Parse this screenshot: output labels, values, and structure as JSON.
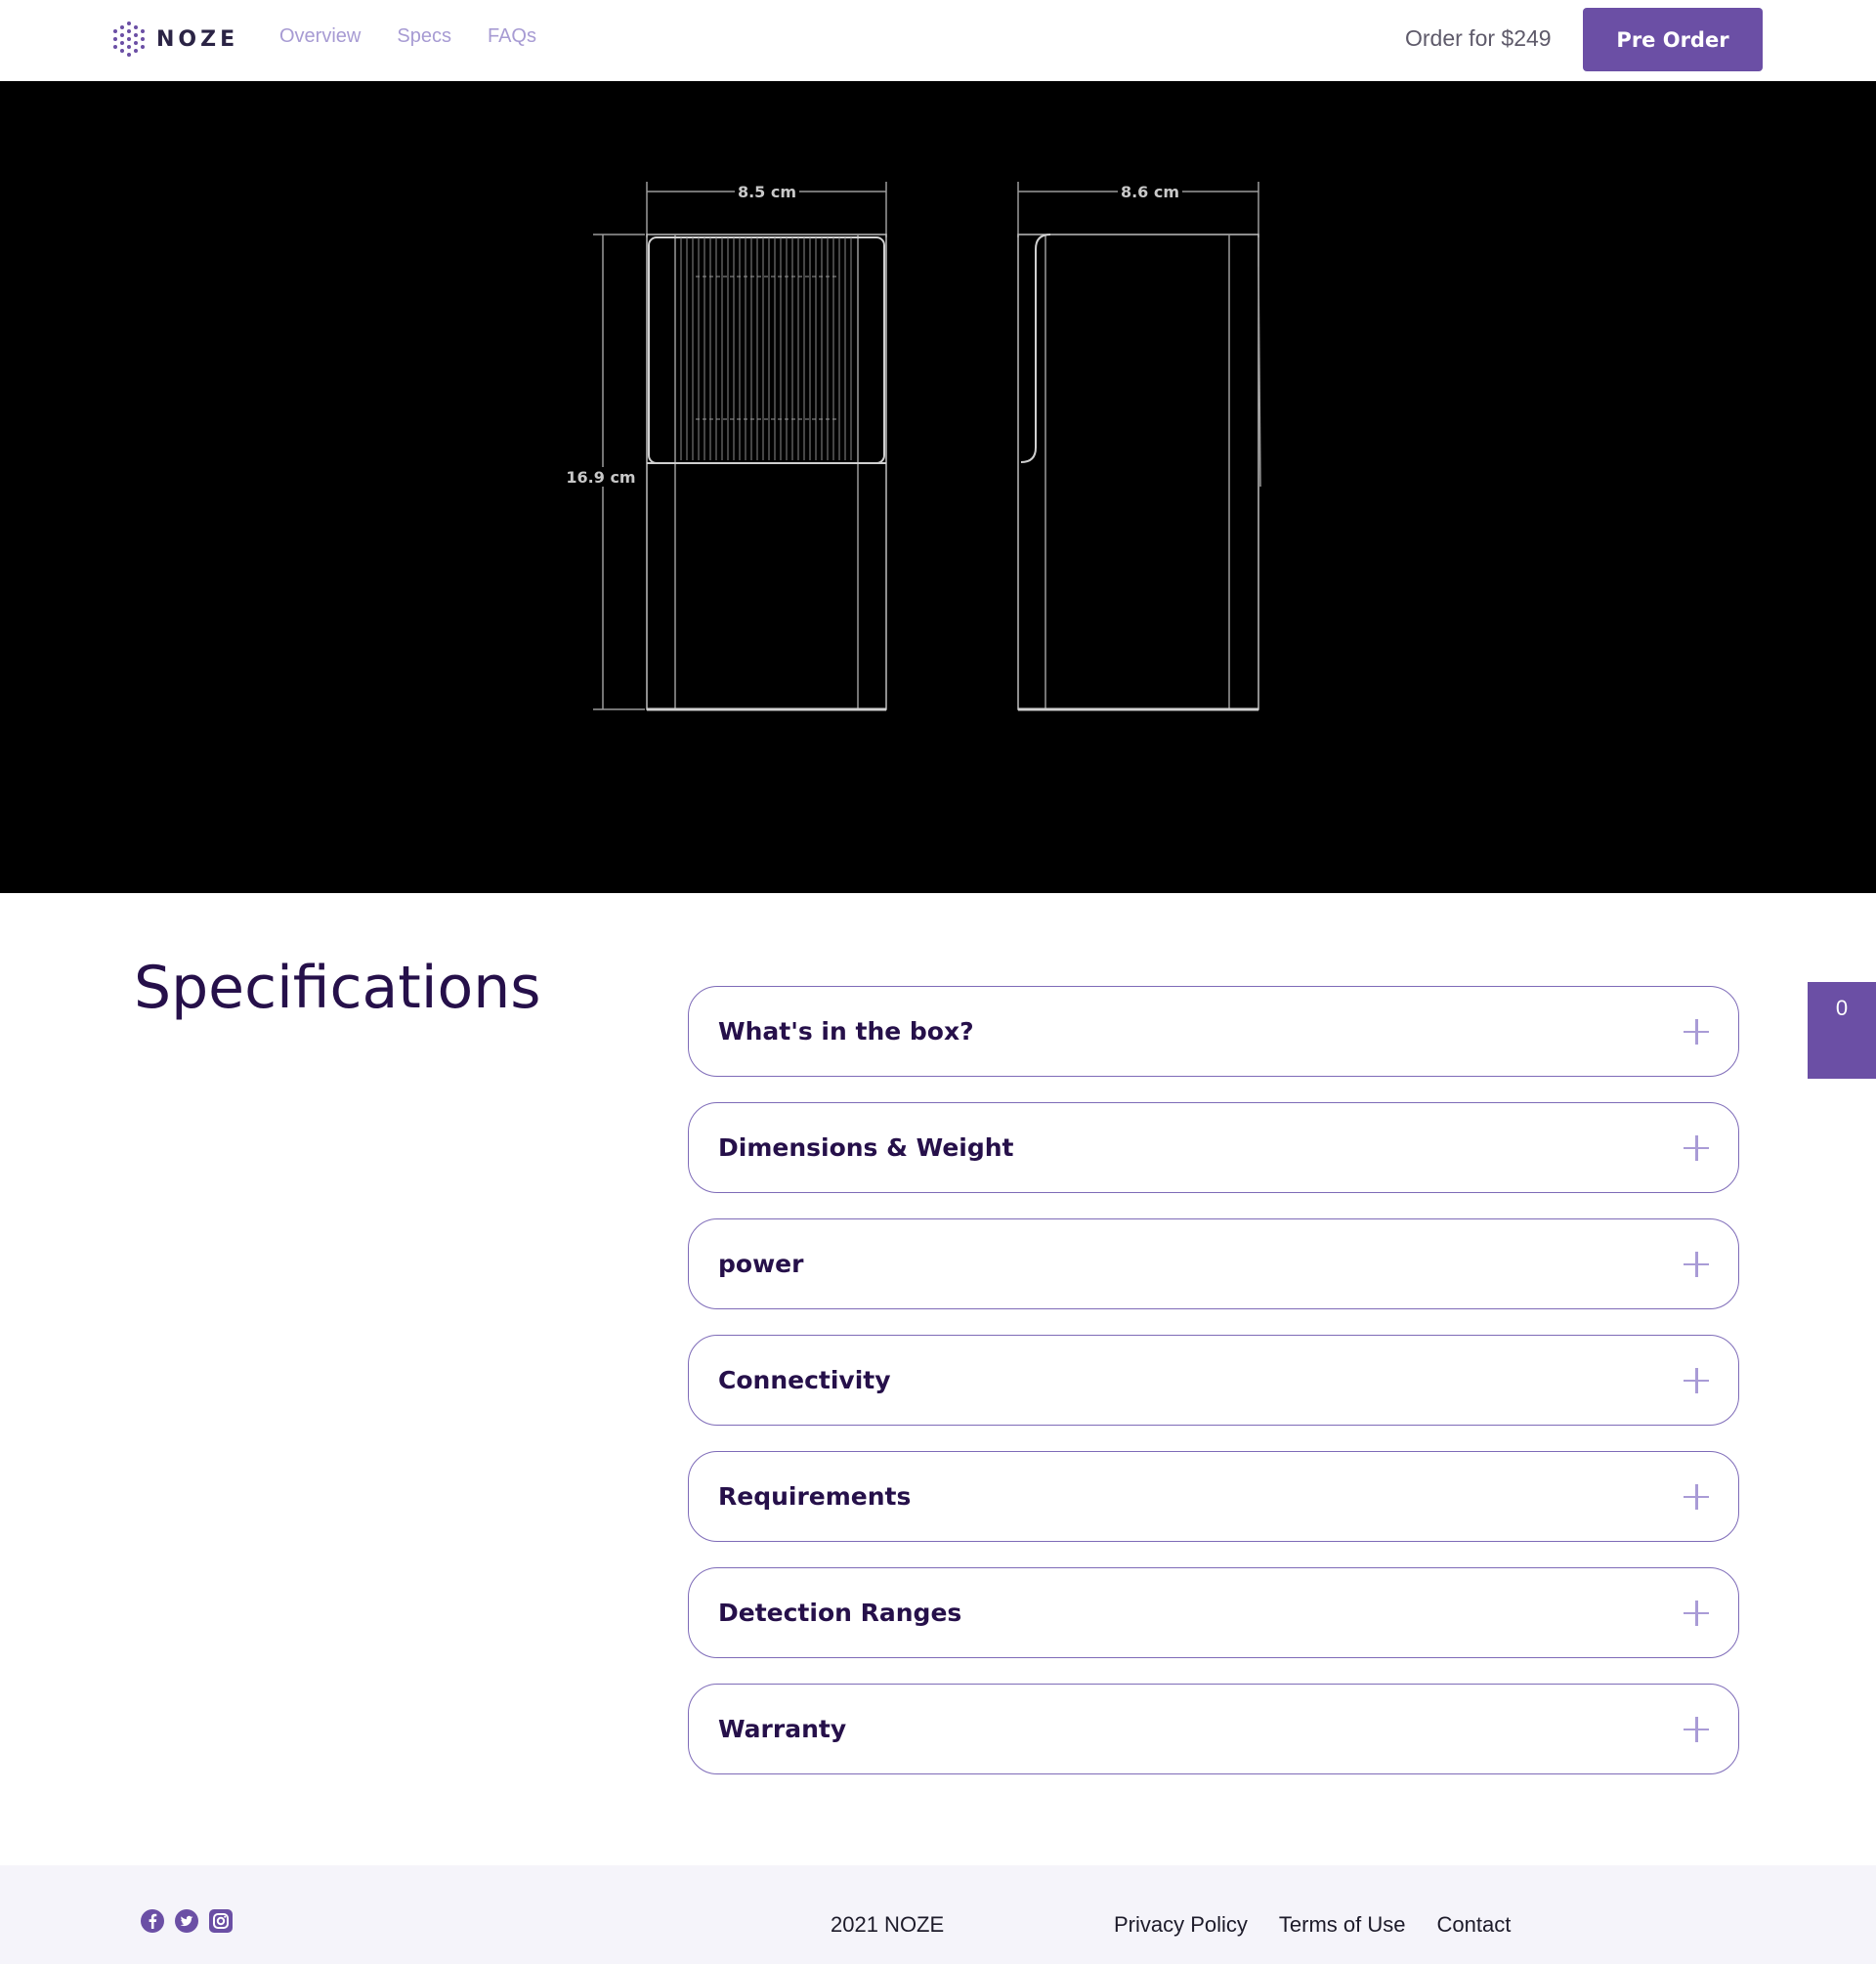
{
  "header": {
    "logo_text": "NOZE",
    "nav": [
      "Overview",
      "Specs",
      "FAQs"
    ],
    "order_text": "Order for $249",
    "preorder_label": "Pre Order"
  },
  "hero": {
    "width_label": "8.5 cm",
    "depth_label": "8.6 cm",
    "height_label": "16.9 cm"
  },
  "specs": {
    "title": "Specifications",
    "items": [
      "What's in the box?",
      "Dimensions & Weight",
      "power",
      "Connectivity",
      "Requirements",
      "Detection Ranges",
      "Warranty"
    ]
  },
  "side_tab": {
    "count": "0"
  },
  "footer": {
    "social_icons": [
      "facebook-icon",
      "twitter-icon",
      "instagram-icon"
    ],
    "copyright": "2021 NOZE",
    "links": [
      "Privacy Policy",
      "Terms of Use",
      "Contact"
    ]
  },
  "colors": {
    "brand": "#6b4fa5",
    "heading": "#26104a",
    "nav": "#a79bd3",
    "accordion_border": "#7e6bb8"
  }
}
